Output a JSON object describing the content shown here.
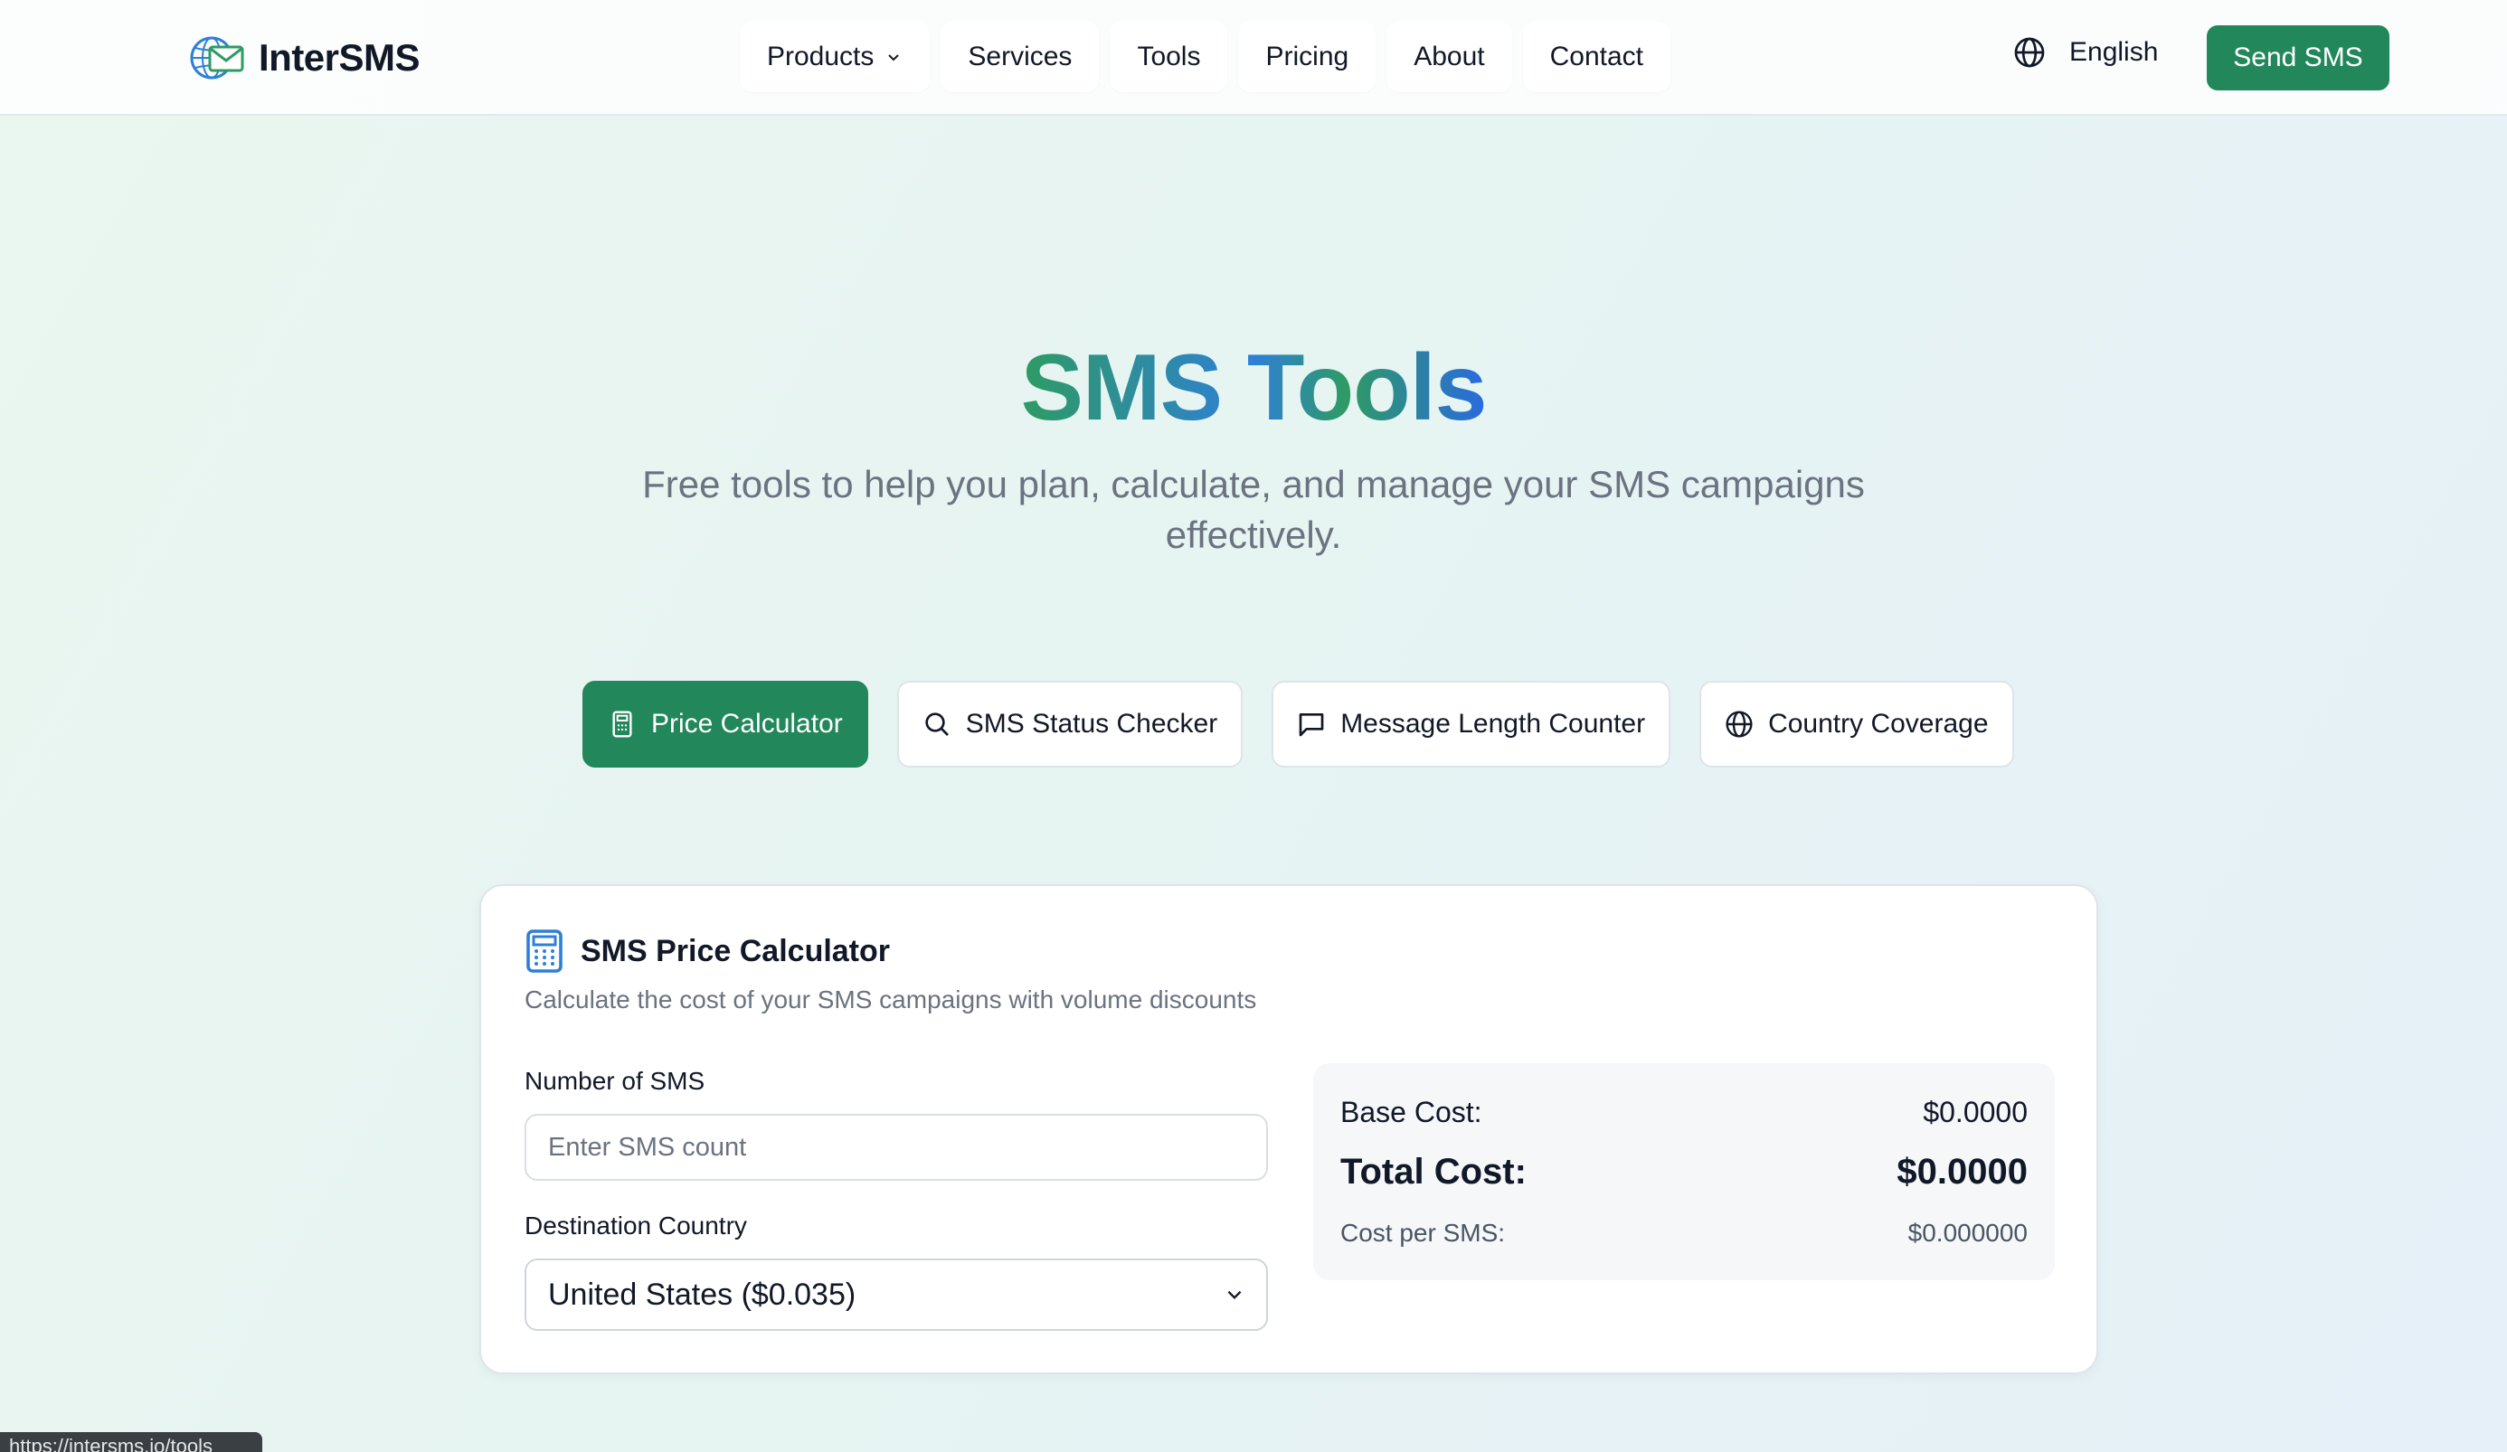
{
  "brand": {
    "name": "InterSMS",
    "logo_icon": "globe-envelope-icon"
  },
  "nav": {
    "items": [
      {
        "label": "Products",
        "has_dropdown": true
      },
      {
        "label": "Services"
      },
      {
        "label": "Tools"
      },
      {
        "label": "Pricing"
      },
      {
        "label": "About"
      },
      {
        "label": "Contact"
      }
    ],
    "language": "English",
    "cta": "Send SMS"
  },
  "hero": {
    "title": "SMS Tools",
    "subtitle": "Free tools to help you plan, calculate, and manage your SMS campaigns effectively."
  },
  "tabs": [
    {
      "label": "Price Calculator",
      "icon": "calculator-icon",
      "active": true
    },
    {
      "label": "SMS Status Checker",
      "icon": "search-icon",
      "active": false
    },
    {
      "label": "Message Length Counter",
      "icon": "message-icon",
      "active": false
    },
    {
      "label": "Country Coverage",
      "icon": "globe-icon",
      "active": false
    }
  ],
  "calculator": {
    "title": "SMS Price Calculator",
    "description": "Calculate the cost of your SMS campaigns with volume discounts",
    "count_label": "Number of SMS",
    "count_placeholder": "Enter SMS count",
    "count_value": "",
    "country_label": "Destination Country",
    "country_selected": "United States ($0.035)",
    "base_cost_label": "Base Cost:",
    "base_cost_value": "$0.0000",
    "total_cost_label": "Total Cost:",
    "total_cost_value": "$0.0000",
    "per_sms_label": "Cost per SMS:",
    "per_sms_value": "$0.000000"
  },
  "status_bar": {
    "url": "https://intersms.io/tools"
  },
  "colors": {
    "primary_green": "#22875a",
    "accent_blue": "#2e7fd8",
    "muted_text": "#6b7280"
  }
}
